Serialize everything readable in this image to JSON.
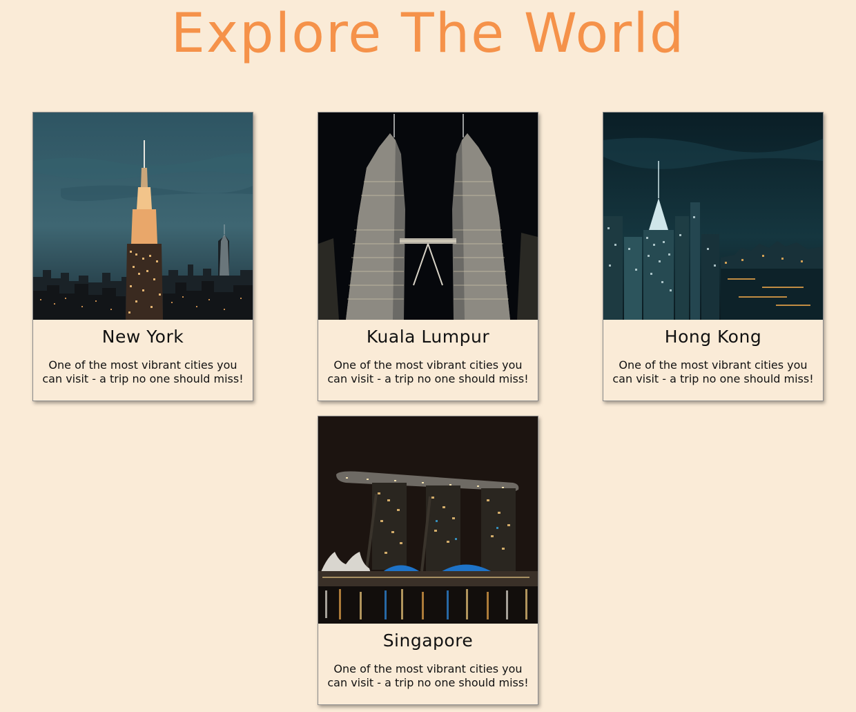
{
  "page": {
    "title": "Explore The World",
    "title_color": "#f5924a",
    "background_color": "#faebd7"
  },
  "cards": [
    {
      "city": "New York",
      "description": "One of the most vibrant cities you can visit - a trip no one should miss!",
      "image": "empire-state-night-skyline"
    },
    {
      "city": "Kuala Lumpur",
      "description": "One of the most vibrant cities you can visit - a trip no one should miss!",
      "image": "petronas-twin-towers-night"
    },
    {
      "city": "Hong Kong",
      "description": "One of the most vibrant cities you can visit - a trip no one should miss!",
      "image": "hong-kong-harbour-night-skyline"
    },
    {
      "city": "Singapore",
      "description": "One of the most vibrant cities you can visit - a trip no one should miss!",
      "image": "marina-bay-sands-night"
    }
  ]
}
